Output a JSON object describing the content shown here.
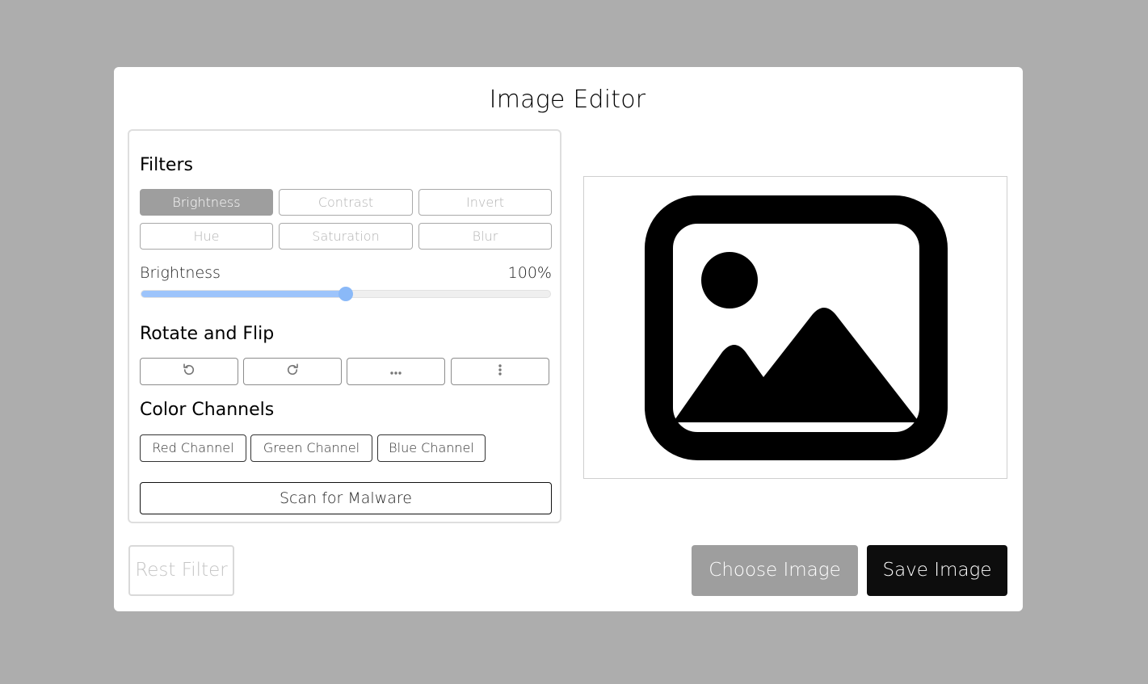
{
  "app": {
    "title": "Image Editor"
  },
  "filters": {
    "heading": "Filters",
    "buttons": [
      {
        "label": "Brightness",
        "active": true
      },
      {
        "label": "Contrast",
        "active": false
      },
      {
        "label": "Invert",
        "active": false
      },
      {
        "label": "Hue",
        "active": false
      },
      {
        "label": "Saturation",
        "active": false
      },
      {
        "label": "Blur",
        "active": false
      }
    ],
    "slider": {
      "name": "Brightness",
      "value_text": "100%",
      "fill_fraction": 0.5
    }
  },
  "rotate_flip": {
    "heading": "Rotate and Flip",
    "buttons": [
      {
        "icon": "rotate-left-icon"
      },
      {
        "icon": "rotate-right-icon"
      },
      {
        "icon": "flip-horizontal-icon"
      },
      {
        "icon": "flip-vertical-icon"
      }
    ]
  },
  "color_channels": {
    "heading": "Color Channels",
    "buttons": [
      {
        "label": "Red Channel"
      },
      {
        "label": "Green Channel"
      },
      {
        "label": "Blue Channel"
      }
    ]
  },
  "scan": {
    "label": "Scan for Malware"
  },
  "preview": {
    "icon": "image-placeholder-icon"
  },
  "footer": {
    "reset_label": "Rest Filter",
    "choose_label": "Choose Image",
    "save_label": "Save Image"
  },
  "colors": {
    "page_background": "#adadad",
    "active_filter": "#9e9e9e",
    "slider_fill": "#9dc4fb",
    "slider_thumb": "#8ab9f8",
    "save_button": "#0d0d0d"
  }
}
